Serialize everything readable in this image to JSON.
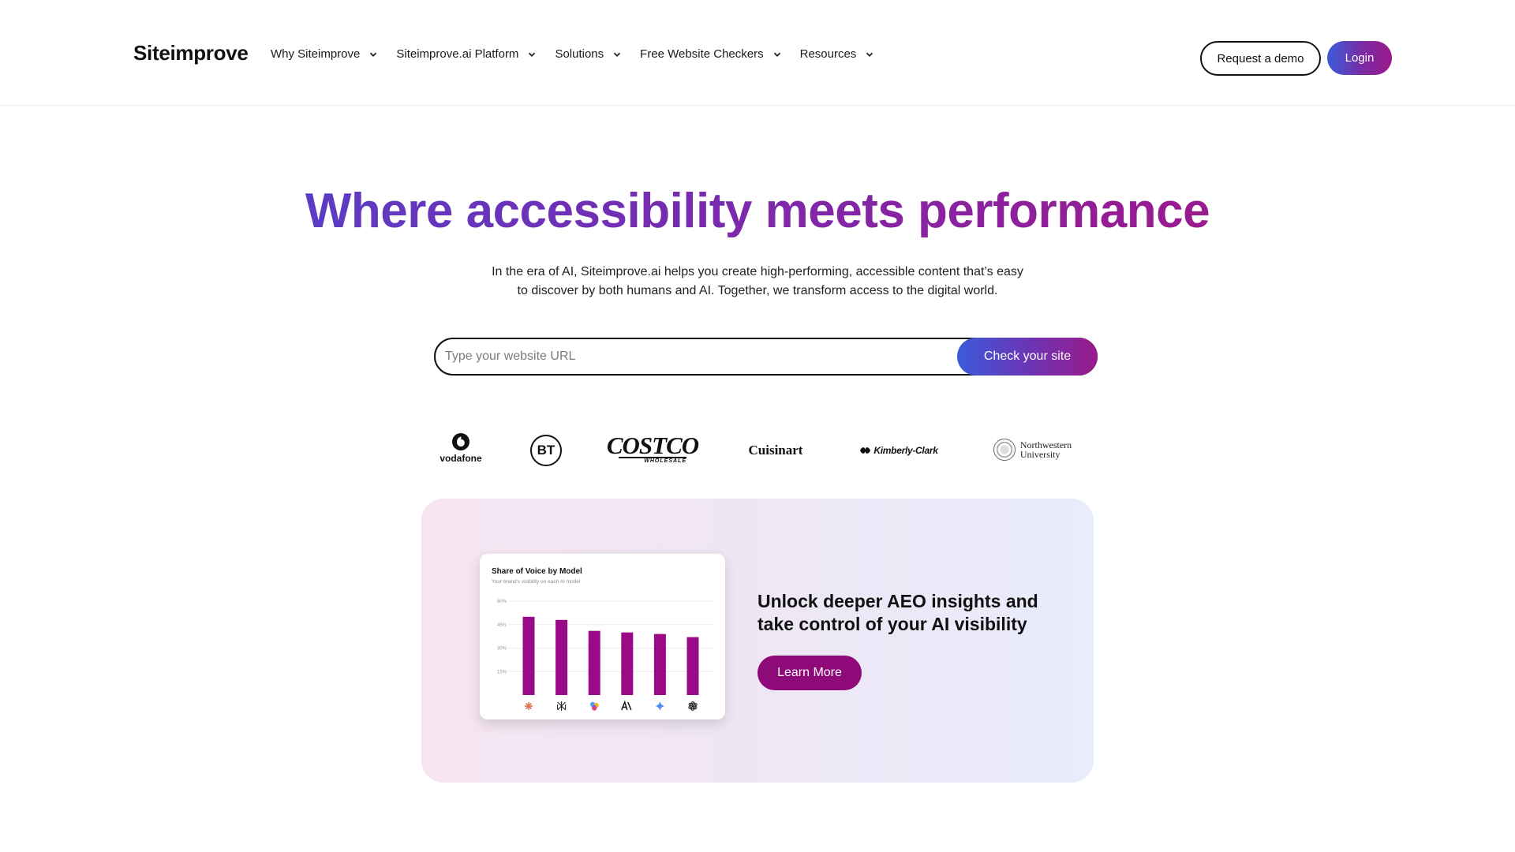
{
  "header": {
    "logo": "Siteimprove",
    "nav": [
      {
        "label": "Why Siteimprove"
      },
      {
        "label": "Siteimprove.ai Platform"
      },
      {
        "label": "Solutions"
      },
      {
        "label": "Free Website Checkers"
      },
      {
        "label": "Resources"
      }
    ],
    "demo_label": "Request a demo",
    "login_label": "Login"
  },
  "hero": {
    "title": "Where accessibility meets performance",
    "subtitle": "In the era of AI, Siteimprove.ai helps you create high-performing, accessible content that’s easy to discover by both humans and AI. Together, we transform access to the digital world.",
    "search_placeholder": "Type your website URL",
    "search_value": "",
    "check_label": "Check your site"
  },
  "logos": {
    "vodafone": "vodafone",
    "bt": "BT",
    "costco_main": "COSTCO",
    "costco_sub": "WHOLESALE",
    "cuisinart": "Cuisinart",
    "kimberly_clark": "Kimberly-Clark",
    "northwestern_line1": "Northwestern",
    "northwestern_line2": "University"
  },
  "promo": {
    "heading": "Unlock deeper AEO insights and take control of your AI visibility",
    "button_label": "Learn More"
  },
  "chart_data": {
    "type": "bar",
    "title": "Share of Voice by Model",
    "subtitle": "Your brand's visibility on each AI model",
    "categories": [
      "claude-icon",
      "perplexity-icon",
      "copilot-icon",
      "anthropic-icon",
      "gemini-icon",
      "openai-icon"
    ],
    "values": [
      50,
      48,
      41,
      40,
      39,
      37
    ],
    "yticks": [
      "15%",
      "30%",
      "45%",
      "60%"
    ],
    "ylim": [
      0,
      60
    ],
    "bar_color": "#9b0a86",
    "grid": true
  },
  "colors": {
    "accent_purple": "#8e0a79",
    "gradient_blue": "#3a5bd9",
    "gradient_magenta": "#9a1a8a"
  }
}
